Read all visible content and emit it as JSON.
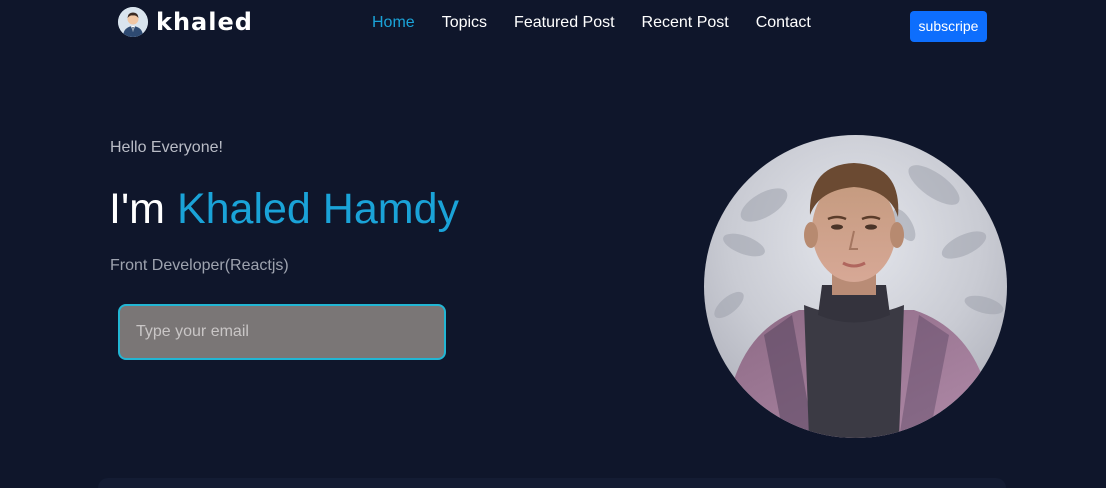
{
  "header": {
    "logo_icon": "user-avatar-icon",
    "logo_text": "khaled",
    "nav": [
      {
        "label": "Home",
        "active": true
      },
      {
        "label": "Topics",
        "active": false
      },
      {
        "label": "Featured Post",
        "active": false
      },
      {
        "label": "Recent Post",
        "active": false
      },
      {
        "label": "Contact",
        "active": false
      }
    ],
    "subscribe_label": "subscripe"
  },
  "hero": {
    "greeting": "Hello Everyone!",
    "headline_prefix": "I'm",
    "headline_name": "Khaled Hamdy",
    "role": "Front Developer(Reactjs)",
    "email_placeholder": "Type your email",
    "email_value": ""
  },
  "colors": {
    "background": "#0f162b",
    "accent": "#1aa3d8",
    "button": "#0d6efd",
    "input_bg": "#7a7676",
    "input_border": "#22b6d4"
  }
}
